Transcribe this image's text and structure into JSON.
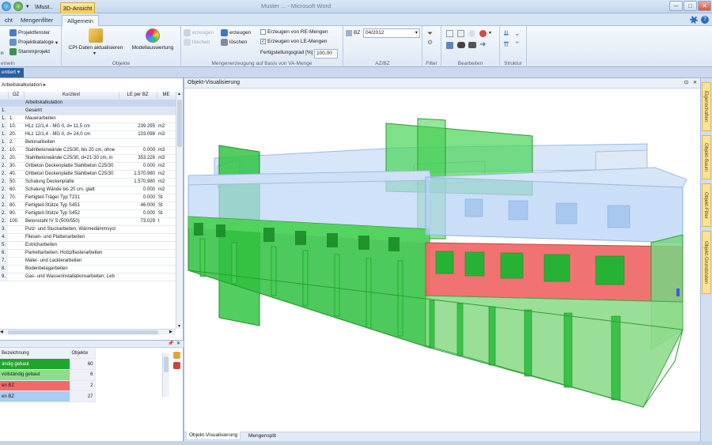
{
  "window": {
    "title": "Muster ...  - Microsoft Word",
    "quick_tab_1": "\\Must..",
    "quick_tab_active": "3D-Ansicht",
    "controls": [
      "─",
      "□",
      "✕"
    ]
  },
  "ribbon_tabs": [
    "cht",
    "Mengenfilter",
    "Allgemein"
  ],
  "ribbon": {
    "group_ansicht": {
      "label": "emein",
      "items": [
        "Projektfenster",
        "Projektkataloge",
        "Stammprojekt"
      ],
      "left_btn": "n"
    },
    "group_objekte": {
      "label": "Objekte",
      "btn_cpi": "CPI-Daten aktualisieren",
      "btn_modell": "Modellauswertung"
    },
    "group_menge": {
      "label": "Mengenerzeugung auf Basis von VA-Menge",
      "erzeugen_dim": "erzeugen",
      "loeschen_dim": "löschen",
      "erzeugen": "erzeugen",
      "loeschen": "löschen",
      "cb_re": "Erzeugen von RE-Mengen",
      "cb_le": "Erzeugen von LE-Mengen",
      "cb_le_checked": "✓",
      "fertig_label": "Fertigstellungsgrad [%]",
      "fertig_value": "100,00"
    },
    "group_azbz": {
      "label": "AZ/BZ",
      "bz_label": "BZ",
      "bz_value": "04/2012"
    },
    "group_filter": {
      "label": "Filter"
    },
    "group_bearbeiten": {
      "label": "Bearbeiten"
    },
    "group_struktur": {
      "label": "Struktur"
    }
  },
  "subbar": {
    "tab": "entiert"
  },
  "left": {
    "breadcrumb": "Arbeitskalkulation ▸",
    "columns": [
      "",
      "OZ",
      "Kurztext",
      "LE per BZ",
      "ME"
    ],
    "rows": [
      {
        "a": "",
        "oz": "",
        "text": "Arbeitskalkulation",
        "le": "",
        "me": "",
        "style": "hl"
      },
      {
        "a": "1.",
        "oz": "",
        "text": "Gesamt",
        "le": "",
        "me": "",
        "style": "sub"
      },
      {
        "a": "1.",
        "oz": "1.",
        "text": "Mauerarbeiten",
        "le": "",
        "me": "",
        "style": ""
      },
      {
        "a": "1.",
        "oz": "10.",
        "text": "HLz 12/1,4 - MG II, d= 11,5 cm",
        "le": "239.295",
        "me": "m2",
        "style": ""
      },
      {
        "a": "1.",
        "oz": "20.",
        "text": "HLz 12/1,4 - MG II, d= 24,0 cm",
        "le": "103.098",
        "me": "m3",
        "style": ""
      },
      {
        "a": "1.",
        "oz": "2.",
        "text": "Betonarbeiten",
        "le": "",
        "me": "",
        "style": ""
      },
      {
        "a": "2.",
        "oz": "10.",
        "text": "Stahlbetonwände C25/30, bis 20 cm, ohne",
        "le": "0.000",
        "me": "m3",
        "style": ""
      },
      {
        "a": "2.",
        "oz": "20.",
        "text": "Stahlbetonwände C25/30, d=21-30 cm, in",
        "le": "353.226",
        "me": "m3",
        "style": ""
      },
      {
        "a": "2.",
        "oz": "30.",
        "text": "Ortbeton Deckenplatte Stahlbeton C25/30",
        "le": "0.000",
        "me": "m2",
        "style": ""
      },
      {
        "a": "2.",
        "oz": "40.",
        "text": "Ortbeton Deckenplatte Stahlbeton C25/30",
        "le": "1.570.980",
        "me": "m2",
        "style": ""
      },
      {
        "a": "2.",
        "oz": "50.",
        "text": "Schalung Deckenplatte",
        "le": "1.570.980",
        "me": "m2",
        "style": ""
      },
      {
        "a": "2.",
        "oz": "60.",
        "text": "Schalung Wände bis 20 cm, glatt",
        "le": "0.000",
        "me": "m2",
        "style": ""
      },
      {
        "a": "2.",
        "oz": "70.",
        "text": "Fertigteil-Träger Typ T231",
        "le": "0.000",
        "me": "St",
        "style": ""
      },
      {
        "a": "2.",
        "oz": "80.",
        "text": "Fertigteil-Stütze Typ S451",
        "le": "46.000",
        "me": "St",
        "style": ""
      },
      {
        "a": "2.",
        "oz": "90.",
        "text": "Fertigteil-Stütze Typ S452",
        "le": "0.000",
        "me": "St",
        "style": ""
      },
      {
        "a": "2.",
        "oz": "100.",
        "text": "Betonstahl IV S (500/550)",
        "le": "73.029",
        "me": "t",
        "style": ""
      },
      {
        "a": "3.",
        "oz": "",
        "text": "Putz- und Stuckarbeiten, Wärmedämmsyst",
        "le": "",
        "me": "",
        "style": ""
      },
      {
        "a": "4.",
        "oz": "",
        "text": "Fliesen- und Plattenarbeiten",
        "le": "",
        "me": "",
        "style": ""
      },
      {
        "a": "5.",
        "oz": "",
        "text": "Estricharbeiten",
        "le": "",
        "me": "",
        "style": ""
      },
      {
        "a": "6.",
        "oz": "",
        "text": "Parkettarbeiten, Holzpflasterarbeiten",
        "le": "",
        "me": "",
        "style": ""
      },
      {
        "a": "7.",
        "oz": "",
        "text": "Maler- und Lackierarbeiten",
        "le": "",
        "me": "",
        "style": ""
      },
      {
        "a": "8.",
        "oz": "",
        "text": "Bodenbelagarbeiten",
        "le": "",
        "me": "",
        "style": ""
      },
      {
        "a": "9.",
        "oz": "",
        "text": "Gas- und Wasserinstallationsarbeiten; Leb",
        "le": "",
        "me": "",
        "style": ""
      }
    ]
  },
  "legend": {
    "columns": [
      "Bezeichnung",
      "Objekte"
    ],
    "rows": [
      {
        "label": "ändig gebaut",
        "count": "60",
        "color": "#1fa62a",
        "textcolor": "#ffffff"
      },
      {
        "label": " vollständig gebaut",
        "count": "6",
        "color": "#8fdc8c",
        "textcolor": "#1a1a1a"
      },
      {
        "label": "en BZ",
        "count": "2",
        "color": "#f06a6a",
        "textcolor": "#1a1a1a"
      },
      {
        "label": "en BZ",
        "count": "27",
        "color": "#a9cdf3",
        "textcolor": "#1a1a1a"
      }
    ]
  },
  "viewport": {
    "title": "Objekt-Visualisierung",
    "tabs": [
      "Objekt-Visualisierung",
      "Mengensplit"
    ]
  },
  "right_tabs": [
    "Eigenschaften",
    "Objekt-Baum",
    "Objekt-Filter",
    "Objekt-Grundstaten"
  ],
  "icons": [
    "gear-icon",
    "help-icon",
    "pin-icon",
    "close-icon",
    "checkbox-icon",
    "dropdown-icon"
  ],
  "colors": {
    "complete": "#1fa62a",
    "partial": "#8fdc8c",
    "late": "#f06a6a",
    "planned": "#a9cdf3"
  }
}
